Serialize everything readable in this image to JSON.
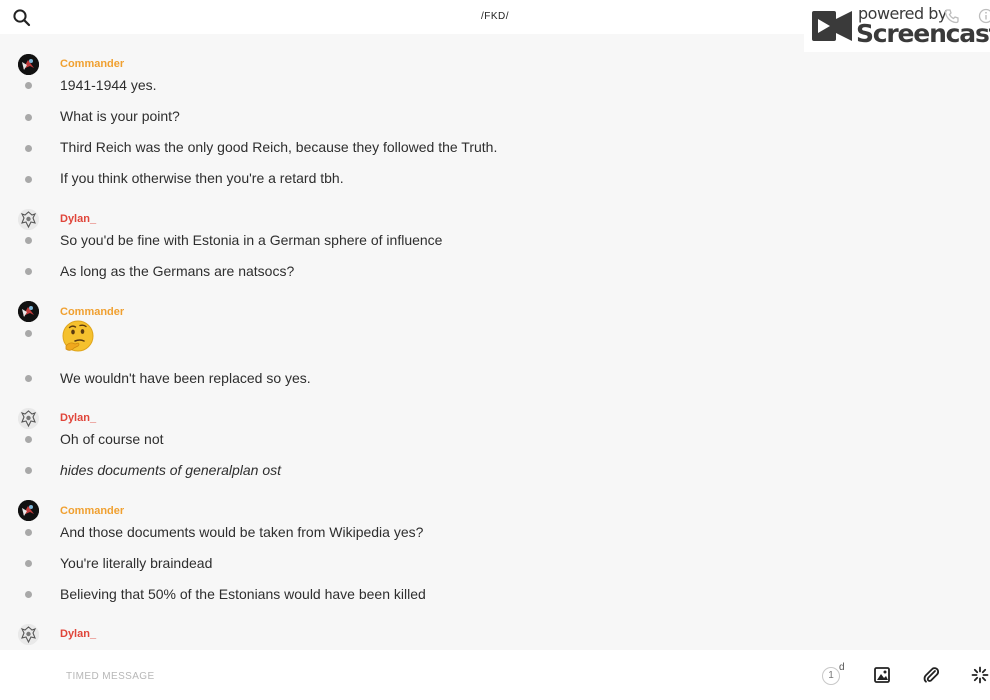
{
  "header": {
    "search_icon": "search-icon",
    "title": "/FKD/"
  },
  "watermark": {
    "small": "powered by",
    "big": "Screencastify"
  },
  "messages": [
    {
      "author": "Commander",
      "avatar": "dark-avatar",
      "lines": [
        {
          "text": "1941-1944 yes."
        },
        {
          "text": "What is your point?"
        },
        {
          "text": "Third Reich was the only good Reich, because they followed the Truth."
        },
        {
          "text": "If you think otherwise then you're a retard tbh."
        }
      ]
    },
    {
      "author": "Dylan_",
      "avatar": "crest-avatar",
      "lines": [
        {
          "text": "So you'd be fine with Estonia in a German sphere of influence"
        },
        {
          "text": "As long as the Germans are natsocs?"
        }
      ]
    },
    {
      "author": "Commander",
      "avatar": "dark-avatar",
      "lines": [
        {
          "emoji": "thinking-face-emoji"
        },
        {
          "text": "We wouldn't have been replaced so yes."
        }
      ]
    },
    {
      "author": "Dylan_",
      "avatar": "crest-avatar",
      "lines": [
        {
          "text": "Oh of course not"
        },
        {
          "text": "hides documents of generalplan ost",
          "italic": true
        }
      ]
    },
    {
      "author": "Commander",
      "avatar": "dark-avatar",
      "lines": [
        {
          "text": "And those documents would be taken from Wikipedia yes?"
        },
        {
          "text": "You're literally braindead"
        },
        {
          "text": "Believing that 50% of the Estonians would have been killed"
        }
      ]
    },
    {
      "author": "Dylan_",
      "avatar": "crest-avatar",
      "lines": []
    }
  ],
  "composer": {
    "placeholder": "TIMED MESSAGE",
    "timer_value": "1",
    "timer_unit": "d",
    "image_icon": "image-icon",
    "attach_icon": "paperclip-icon",
    "more_icon": "sparkle-icon"
  },
  "colors": {
    "commander": "#f0a030",
    "dylan": "#e0453a",
    "bullet": "#a9a9a9",
    "background": "#f7f7f7"
  }
}
